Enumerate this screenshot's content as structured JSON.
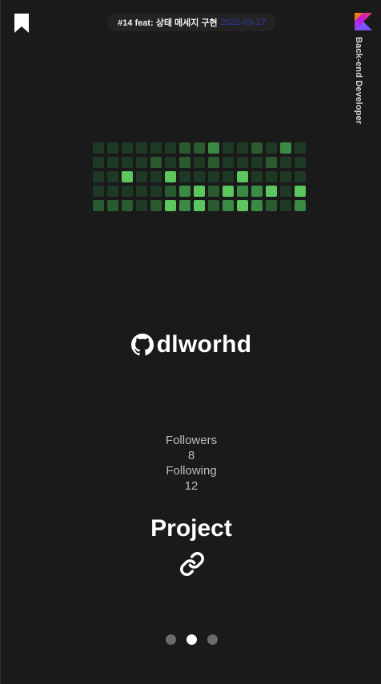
{
  "header": {
    "commit_text": "#14 feat: 상태 메세지 구현",
    "commit_date": "2022-03-17",
    "side_title": "Back-end Developer"
  },
  "icons": {
    "bookmark": "bookmark-icon",
    "kotlin": "kotlin-logo-icon",
    "github": "github-icon",
    "link": "link-icon"
  },
  "colors": {
    "background": "#1a1a1a",
    "grass_levels": [
      "#1f3a24",
      "#2a5a30",
      "#3b8a44",
      "#5cc65f"
    ],
    "dot_active": "#ffffff",
    "dot_inactive": "#6b6b6b"
  },
  "contributions": [
    [
      0,
      0,
      0,
      0,
      0,
      0,
      1,
      1,
      2,
      0,
      0,
      1,
      0,
      2,
      0
    ],
    [
      0,
      0,
      0,
      0,
      1,
      0,
      1,
      0,
      1,
      0,
      0,
      0,
      1,
      0,
      0
    ],
    [
      0,
      0,
      3,
      0,
      0,
      3,
      0,
      0,
      0,
      0,
      3,
      0,
      0,
      0,
      0
    ],
    [
      0,
      0,
      0,
      0,
      0,
      1,
      2,
      3,
      1,
      3,
      2,
      2,
      3,
      0,
      3
    ],
    [
      1,
      1,
      1,
      0,
      1,
      3,
      2,
      3,
      1,
      2,
      3,
      2,
      1,
      0,
      2
    ]
  ],
  "profile": {
    "username": "dlworhd",
    "followers_label": "Followers",
    "followers_count": "8",
    "following_label": "Following",
    "following_count": "12"
  },
  "project": {
    "title": "Project"
  },
  "pagination": {
    "total": 3,
    "active_index": 1
  }
}
